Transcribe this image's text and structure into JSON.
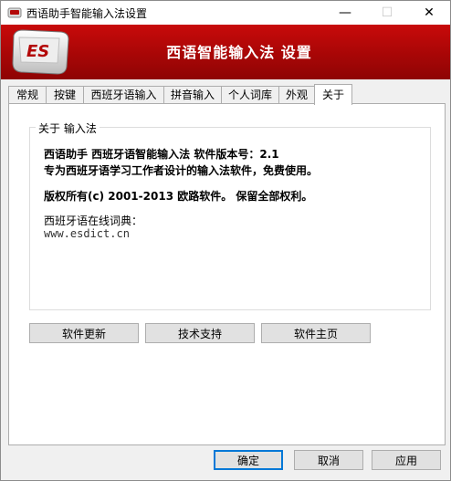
{
  "window": {
    "title": "西语助手智能输入法设置",
    "min_glyph": "—",
    "max_glyph": "☐",
    "close_glyph": "✕"
  },
  "banner": {
    "logo_text": "ES",
    "title": "西语智能输入法 设置"
  },
  "tabs": [
    {
      "label": "常规"
    },
    {
      "label": "按键"
    },
    {
      "label": "西班牙语输入"
    },
    {
      "label": "拼音输入"
    },
    {
      "label": "个人词库"
    },
    {
      "label": "外观"
    },
    {
      "label": "关于"
    }
  ],
  "active_tab": "关于",
  "about": {
    "group_title": "关于 输入法",
    "line1": "西语助手 西班牙语智能输入法 软件版本号：2.1",
    "line2": "专为西班牙语学习工作者设计的输入法软件，免费使用。",
    "line3": "版权所有(c) 2001-2013 欧路软件。 保留全部权利。",
    "line4": "西班牙语在线词典：",
    "url": "www.esdict.cn"
  },
  "panel_buttons": {
    "update": "软件更新",
    "support": "技术支持",
    "homepage": "软件主页"
  },
  "dialog_buttons": {
    "ok": "确定",
    "cancel": "取消",
    "apply": "应用"
  },
  "colors": {
    "banner_red": "#b40808",
    "focus_blue": "#0078d7"
  }
}
